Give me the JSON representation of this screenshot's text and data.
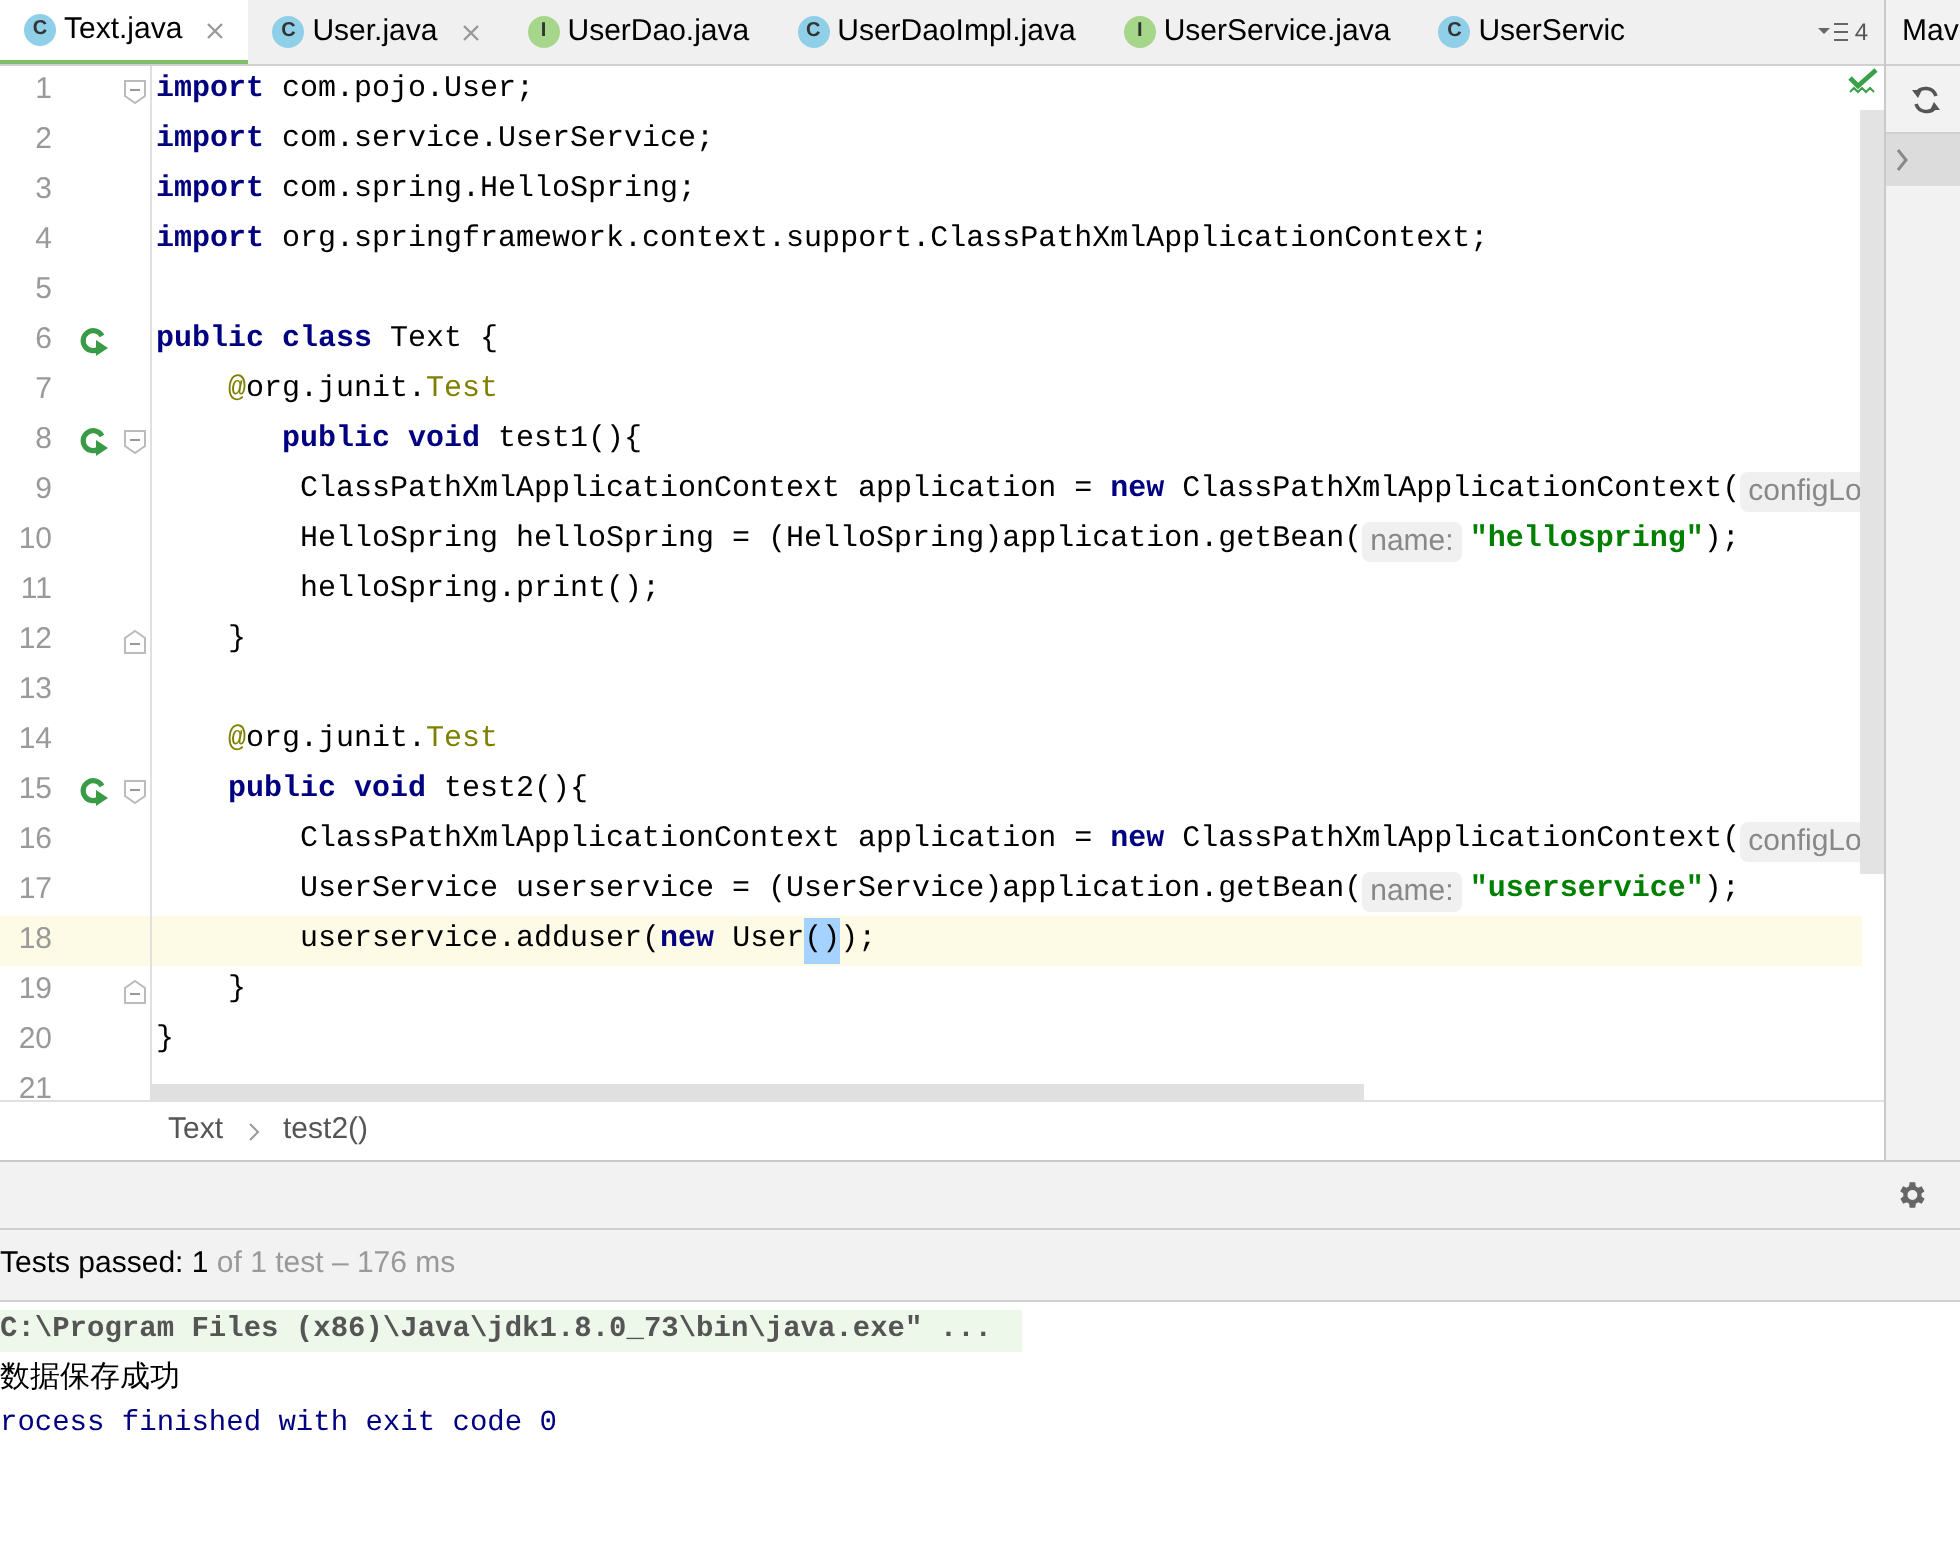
{
  "tabs": [
    {
      "icon": "C",
      "kind": "class",
      "label": "Text.java",
      "selected": true,
      "closable": true
    },
    {
      "icon": "C",
      "kind": "class",
      "label": "User.java",
      "selected": false,
      "closable": true
    },
    {
      "icon": "I",
      "kind": "interface",
      "label": "UserDao.java",
      "selected": false,
      "closable": false
    },
    {
      "icon": "C",
      "kind": "class",
      "label": "UserDaoImpl.java",
      "selected": false,
      "closable": false
    },
    {
      "icon": "I",
      "kind": "interface",
      "label": "UserService.java",
      "selected": false,
      "closable": false
    },
    {
      "icon": "C",
      "kind": "class",
      "label": "UserServic",
      "selected": false,
      "closable": false
    }
  ],
  "tab_overflow": {
    "count": "4"
  },
  "side_panel": {
    "title": "Mav"
  },
  "editor": {
    "lines": [
      {
        "number": "1",
        "run": false,
        "fold_start": true,
        "fold_end": false,
        "current": false,
        "tokens": [
          {
            "kind": "kw",
            "text": "import"
          },
          {
            "kind": "plain",
            "text": " com.pojo.User;"
          }
        ]
      },
      {
        "number": "2",
        "run": false,
        "fold_start": false,
        "fold_end": false,
        "current": false,
        "tokens": [
          {
            "kind": "kw",
            "text": "import"
          },
          {
            "kind": "plain",
            "text": " com.service.UserService;"
          }
        ]
      },
      {
        "number": "3",
        "run": false,
        "fold_start": false,
        "fold_end": false,
        "current": false,
        "tokens": [
          {
            "kind": "kw",
            "text": "import"
          },
          {
            "kind": "plain",
            "text": " com.spring.HelloSpring;"
          }
        ]
      },
      {
        "number": "4",
        "run": false,
        "fold_start": false,
        "fold_end": false,
        "current": false,
        "tokens": [
          {
            "kind": "kw",
            "text": "import"
          },
          {
            "kind": "plain",
            "text": " org.springframework.context.support.ClassPathXmlApplicationContext;"
          }
        ]
      },
      {
        "number": "5",
        "run": false,
        "fold_start": false,
        "fold_end": false,
        "current": false
      },
      {
        "number": "6",
        "run": true,
        "fold_start": false,
        "fold_end": false,
        "current": false,
        "tokens": [
          {
            "kind": "kw",
            "text": "public class"
          },
          {
            "kind": "plain",
            "text": " Text {"
          }
        ]
      },
      {
        "number": "7",
        "run": false,
        "fold_start": false,
        "fold_end": false,
        "current": false,
        "tokens": [
          {
            "kind": "ann",
            "text": "    @"
          },
          {
            "kind": "plain",
            "text": "org.junit."
          },
          {
            "kind": "ann",
            "text": "Test"
          }
        ]
      },
      {
        "number": "8",
        "run": true,
        "fold_start": true,
        "fold_end": false,
        "current": false,
        "tokens": [
          {
            "kind": "kw",
            "text": "       public void"
          },
          {
            "kind": "plain",
            "text": " test1(){"
          }
        ]
      },
      {
        "number": "9",
        "run": false,
        "fold_start": false,
        "fold_end": false,
        "current": false,
        "tokens": [
          {
            "kind": "plain",
            "text": "        ClassPathXmlApplicationContext application = "
          },
          {
            "kind": "kw",
            "text": "new"
          },
          {
            "kind": "plain",
            "text": " ClassPathXmlApplicationContext("
          },
          {
            "kind": "hint",
            "text": "configLo"
          }
        ]
      },
      {
        "number": "10",
        "run": false,
        "fold_start": false,
        "fold_end": false,
        "current": false,
        "tokens": [
          {
            "kind": "plain",
            "text": "        HelloSpring helloSpring = (HelloSpring)application.getBean("
          },
          {
            "kind": "hint",
            "text": "name:"
          },
          {
            "kind": "string",
            "text": "\"hellospring\""
          },
          {
            "kind": "plain",
            "text": ");"
          }
        ]
      },
      {
        "number": "11",
        "run": false,
        "fold_start": false,
        "fold_end": false,
        "current": false,
        "tokens": [
          {
            "kind": "plain",
            "text": "        helloSpring.print();"
          }
        ]
      },
      {
        "number": "12",
        "run": false,
        "fold_start": false,
        "fold_end": true,
        "current": false,
        "tokens": [
          {
            "kind": "plain",
            "text": "    }"
          }
        ]
      },
      {
        "number": "13",
        "run": false,
        "fold_start": false,
        "fold_end": false,
        "current": false
      },
      {
        "number": "14",
        "run": false,
        "fold_start": false,
        "fold_end": false,
        "current": false,
        "tokens": [
          {
            "kind": "ann",
            "text": "    @"
          },
          {
            "kind": "plain",
            "text": "org.junit."
          },
          {
            "kind": "ann",
            "text": "Test"
          }
        ]
      },
      {
        "number": "15",
        "run": true,
        "fold_start": true,
        "fold_end": false,
        "current": false,
        "tokens": [
          {
            "kind": "kw",
            "text": "    public void"
          },
          {
            "kind": "plain",
            "text": " test2(){"
          }
        ]
      },
      {
        "number": "16",
        "run": false,
        "fold_start": false,
        "fold_end": false,
        "current": false,
        "tokens": [
          {
            "kind": "plain",
            "text": "        ClassPathXmlApplicationContext application = "
          },
          {
            "kind": "kw",
            "text": "new"
          },
          {
            "kind": "plain",
            "text": " ClassPathXmlApplicationContext("
          },
          {
            "kind": "hint",
            "text": "configLo"
          }
        ]
      },
      {
        "number": "17",
        "run": false,
        "fold_start": false,
        "fold_end": false,
        "current": false,
        "tokens": [
          {
            "kind": "plain",
            "text": "        UserService userservice = (UserService)application.getBean("
          },
          {
            "kind": "hint",
            "text": "name:"
          },
          {
            "kind": "string",
            "text": "\"userservice\""
          },
          {
            "kind": "plain",
            "text": ");"
          }
        ]
      },
      {
        "number": "18",
        "run": false,
        "fold_start": false,
        "fold_end": false,
        "current": true,
        "tokens": [
          {
            "kind": "plain",
            "text": "        userservice.adduser("
          },
          {
            "kind": "kw",
            "text": "new"
          },
          {
            "kind": "plain",
            "text": " User"
          },
          {
            "kind": "selection",
            "text": "()"
          },
          {
            "kind": "plain",
            "text": ");"
          }
        ]
      },
      {
        "number": "19",
        "run": false,
        "fold_start": false,
        "fold_end": true,
        "current": false,
        "tokens": [
          {
            "kind": "plain",
            "text": "    }"
          }
        ]
      },
      {
        "number": "20",
        "run": false,
        "fold_start": false,
        "fold_end": false,
        "current": false,
        "tokens": [
          {
            "kind": "plain",
            "text": "}"
          }
        ]
      },
      {
        "number": "21",
        "run": false,
        "fold_start": false,
        "fold_end": false,
        "current": false
      }
    ]
  },
  "breadcrumbs": [
    "Text",
    "test2()"
  ],
  "test_status": {
    "label": "Tests passed:",
    "count": "1",
    "detail": "of 1 test – 176 ms"
  },
  "console": [
    {
      "kind": "command",
      "text": "C:\\Program Files (x86)\\Java\\jdk1.8.0_73\\bin\\java.exe\" ..."
    },
    {
      "kind": "output",
      "text": "数据保存成功"
    },
    {
      "kind": "exit",
      "text": "rocess finished with exit code 0"
    }
  ]
}
